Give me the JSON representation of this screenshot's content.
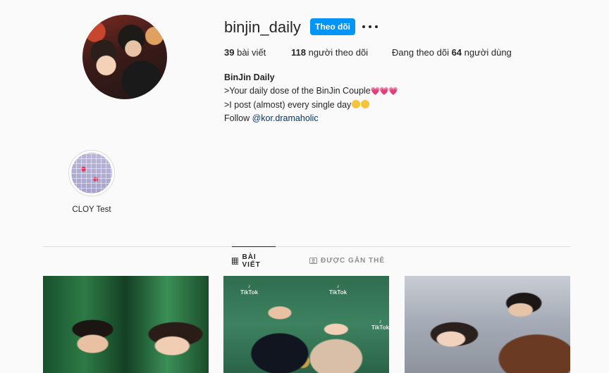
{
  "profile": {
    "username": "binjin_daily",
    "follow_label": "Theo dõi",
    "more_icon": "more-options-icon"
  },
  "stats": {
    "posts_count": "39",
    "posts_label": "bài viết",
    "followers_count": "118",
    "followers_label": "người theo dõi",
    "following_prefix": "Đang theo dõi",
    "following_count": "64",
    "following_suffix": "người dùng"
  },
  "bio": {
    "name": "BinJin Daily",
    "line1": ">Your daily dose of the BinJin Couple",
    "line1_emoji": "💗💗💗",
    "line2": ">I post (almost) every single day",
    "line3_prefix": "Follow ",
    "line3_link": "@kor.dramaholic"
  },
  "highlights": [
    {
      "label": "CLOY Test"
    }
  ],
  "tabs": [
    {
      "label": "BÀI VIẾT",
      "icon": "grid-icon",
      "active": true
    },
    {
      "label": "ĐƯỢC GẮN THẺ",
      "icon": "tagged-icon",
      "active": false
    }
  ],
  "posts": [
    {
      "id": "post-1"
    },
    {
      "id": "post-2",
      "overlay_text": "TikTok"
    },
    {
      "id": "post-3"
    }
  ],
  "colors": {
    "accent": "#0095f6",
    "link": "#00376b",
    "background": "#fafafa",
    "divider": "#dbdbdb"
  }
}
